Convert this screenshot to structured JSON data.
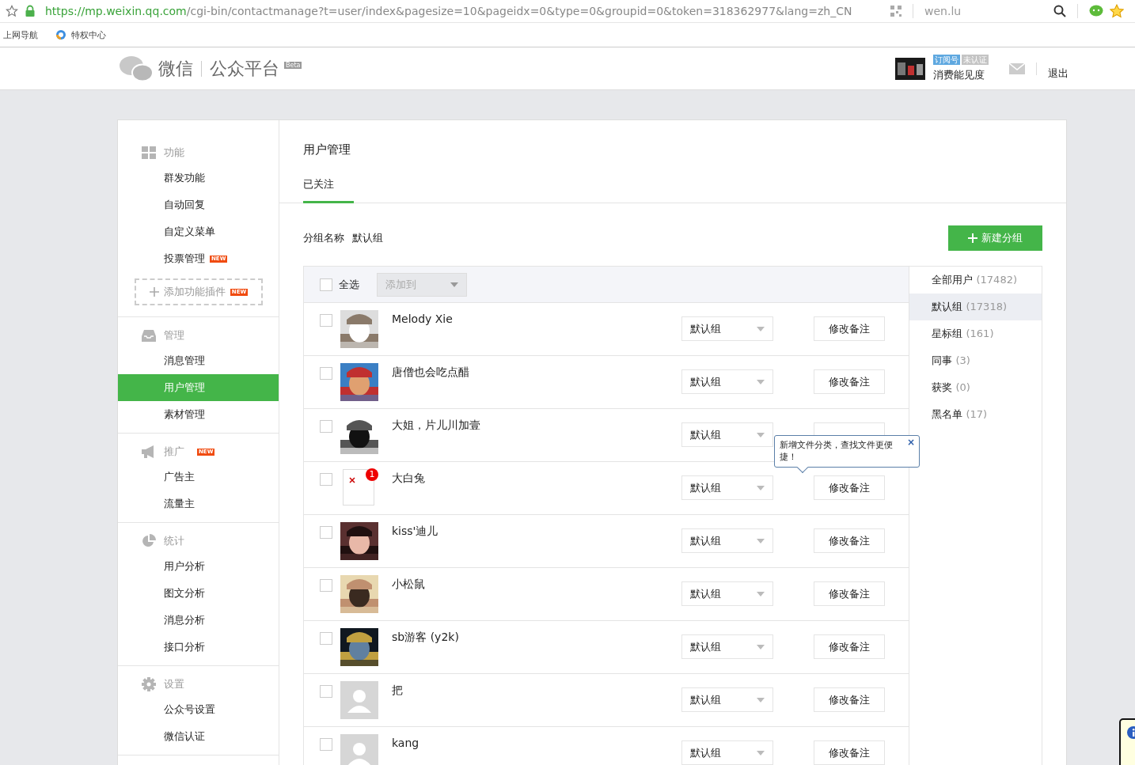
{
  "browser": {
    "url_host": "https://mp.weixin.qq.com",
    "url_path": "/cgi-bin/contactmanage?t=user/index&pagesize=10&pageidx=0&type=0&groupid=0&token=318362977&lang=zh_CN",
    "search": "wen.lu",
    "bookmarks": [
      "上网导航",
      "特权中心"
    ]
  },
  "header": {
    "logo": "微信",
    "product": "公众平台",
    "beta": "Beta",
    "account_tags": [
      {
        "label": "订阅号",
        "color": "#5fa8e0"
      },
      {
        "label": "未认证",
        "color": "#c4c4c4"
      }
    ],
    "account_name": "消费能见度",
    "logout": "退出"
  },
  "sidebar": [
    {
      "title": "功能",
      "kind": "grid",
      "items": [
        {
          "label": "群发功能",
          "selected": false
        },
        {
          "label": "自动回复",
          "selected": false
        },
        {
          "label": "自定义菜单",
          "selected": false
        },
        {
          "label": "投票管理",
          "selected": false,
          "badge": "NEW"
        }
      ],
      "plugin": {
        "label": "添加功能插件",
        "badge": "NEW"
      }
    },
    {
      "title": "管理",
      "kind": "tray",
      "items": [
        {
          "label": "消息管理",
          "selected": false
        },
        {
          "label": "用户管理",
          "selected": true
        },
        {
          "label": "素材管理",
          "selected": false
        }
      ]
    },
    {
      "title": "推广",
      "kind": "megaphone",
      "badge": "NEW",
      "items": [
        {
          "label": "广告主",
          "selected": false
        },
        {
          "label": "流量主",
          "selected": false
        }
      ]
    },
    {
      "title": "统计",
      "kind": "pie",
      "items": [
        {
          "label": "用户分析",
          "selected": false
        },
        {
          "label": "图文分析",
          "selected": false
        },
        {
          "label": "消息分析",
          "selected": false
        },
        {
          "label": "接口分析",
          "selected": false
        }
      ]
    },
    {
      "title": "设置",
      "kind": "gear",
      "items": [
        {
          "label": "公众号设置",
          "selected": false
        },
        {
          "label": "微信认证",
          "selected": false
        }
      ]
    }
  ],
  "page_title": "用户管理",
  "tabs": [
    {
      "label": "已关注",
      "selected": true
    }
  ],
  "group_label": "分组名称",
  "group_name": "默认组",
  "new_group_button": "新建分组",
  "toolbar": {
    "select_all": "全选",
    "checked": false,
    "add_to": "添加到"
  },
  "users": [
    {
      "name": "Melody Xie",
      "checked": false,
      "group": "默认组",
      "remark_button": "修改备注"
    },
    {
      "name": "唐僧也会吃点醋",
      "checked": false,
      "group": "默认组",
      "remark_button": "修改备注"
    },
    {
      "name": "大姐，片儿川加壹",
      "checked": false,
      "group": "默认组"
    },
    {
      "name": "大白兔",
      "kind": "broken",
      "badge": "1",
      "checked": false,
      "group": "默认组",
      "remark_button": "修改备注"
    },
    {
      "name": "kiss'迪儿",
      "checked": false,
      "group": "默认组",
      "remark_button": "修改备注"
    },
    {
      "name": "小松鼠",
      "checked": false,
      "group": "默认组",
      "remark_button": "修改备注"
    },
    {
      "name": "sb游客 (y2k)",
      "checked": false,
      "group": "默认组",
      "remark_button": "修改备注"
    },
    {
      "name": "把",
      "kind": "default",
      "checked": false,
      "group": "默认组",
      "remark_button": "修改备注"
    },
    {
      "name": "kang",
      "kind": "default",
      "checked": false,
      "group": "默认组",
      "remark_button": "修改备注"
    }
  ],
  "groups": [
    {
      "name": "全部用户",
      "count": "(17482)",
      "selected": false
    },
    {
      "name": "默认组",
      "count": "(17318)",
      "selected": true
    },
    {
      "name": "星标组",
      "count": "(161)",
      "selected": false
    },
    {
      "name": "同事",
      "count": "(3)",
      "selected": false
    },
    {
      "name": "获奖",
      "count": "(0)",
      "selected": false
    },
    {
      "name": "黑名单",
      "count": "(17)",
      "selected": false
    }
  ],
  "tooltip": "新增文件分类，查找文件更便捷！",
  "tooltip_close": "×"
}
